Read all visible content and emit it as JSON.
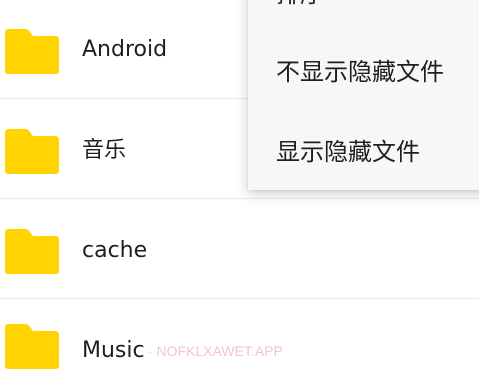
{
  "file_list": {
    "rows": [
      {
        "icon": "folder-icon",
        "label": "Android"
      },
      {
        "icon": "folder-icon",
        "label": "音乐"
      },
      {
        "icon": "folder-icon",
        "label": "cache"
      },
      {
        "icon": "folder-icon",
        "label": "Music"
      }
    ]
  },
  "overflow_menu": {
    "items": [
      {
        "label": "排序"
      },
      {
        "label": "不显示隐藏文件"
      },
      {
        "label": "显示隐藏文件"
      }
    ]
  },
  "watermark": {
    "text": "· NOFKLXAWET.APP"
  },
  "colors": {
    "folder": "#FFD400",
    "text": "#1F1F1F",
    "menu_background": "#F7F7F7",
    "divider": "#EAEAEA"
  }
}
